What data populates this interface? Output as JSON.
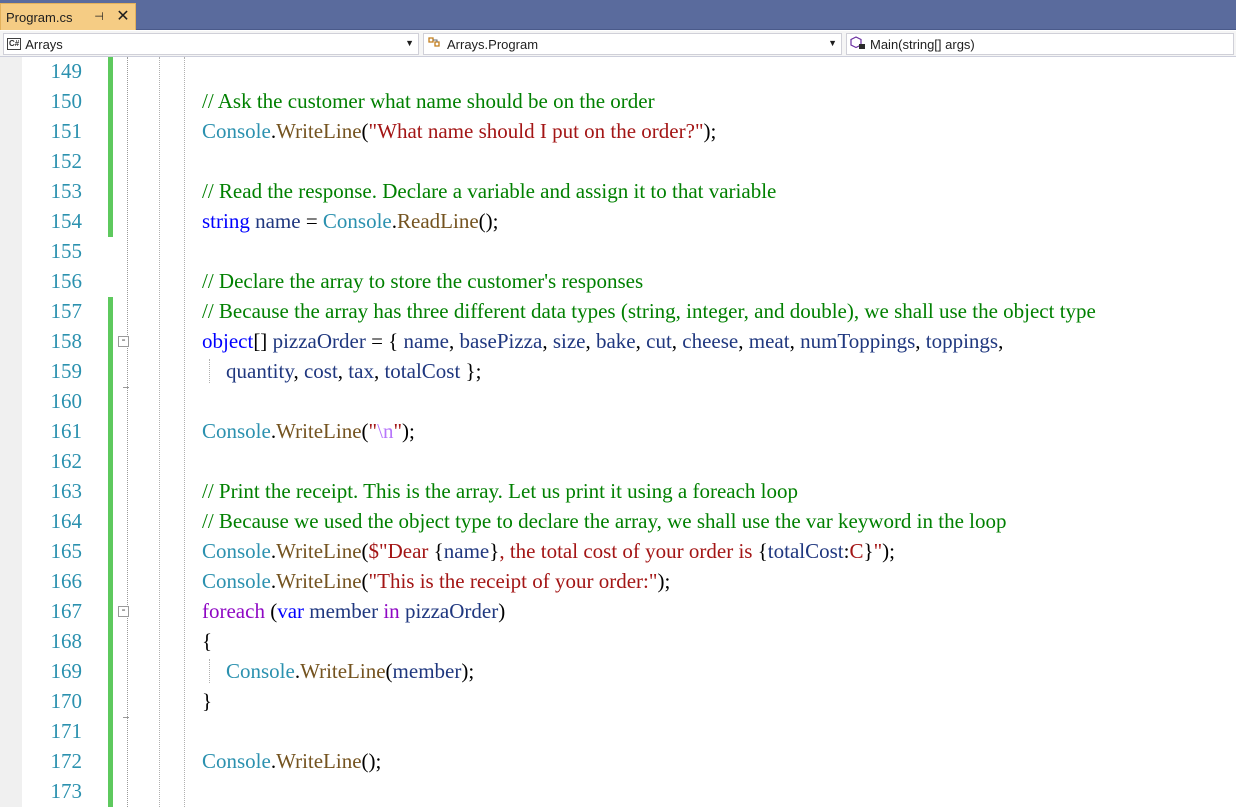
{
  "tab": {
    "title": "Program.cs",
    "pin_glyph": "⊣",
    "close_glyph": "✕"
  },
  "navbar": {
    "project": {
      "badge": "C#",
      "label": "Arrays"
    },
    "type": {
      "label": "Arrays.Program"
    },
    "member": {
      "label": "Main(string[] args)"
    }
  },
  "editor": {
    "line_numbers": [
      "149",
      "150",
      "151",
      "152",
      "153",
      "154",
      "155",
      "156",
      "157",
      "158",
      "159",
      "160",
      "161",
      "162",
      "163",
      "164",
      "165",
      "166",
      "167",
      "168",
      "169",
      "170",
      "171",
      "172",
      "173"
    ],
    "lines": [
      {
        "tokens": []
      },
      {
        "tokens": [
          {
            "t": "// Ask the customer what name should be on the order",
            "c": "com"
          }
        ]
      },
      {
        "tokens": [
          {
            "t": "Console",
            "c": "type"
          },
          {
            "t": ".",
            "c": ""
          },
          {
            "t": "WriteLine",
            "c": "meth"
          },
          {
            "t": "(",
            "c": ""
          },
          {
            "t": "\"What name should I put on the order?\"",
            "c": "str"
          },
          {
            "t": ");",
            "c": ""
          }
        ]
      },
      {
        "tokens": []
      },
      {
        "tokens": [
          {
            "t": "// Read the response. Declare a variable and assign it to that variable",
            "c": "com"
          }
        ]
      },
      {
        "tokens": [
          {
            "t": "string",
            "c": "kw"
          },
          {
            "t": " ",
            "c": ""
          },
          {
            "t": "name",
            "c": "var"
          },
          {
            "t": " = ",
            "c": ""
          },
          {
            "t": "Console",
            "c": "type"
          },
          {
            "t": ".",
            "c": ""
          },
          {
            "t": "ReadLine",
            "c": "meth"
          },
          {
            "t": "();",
            "c": ""
          }
        ]
      },
      {
        "tokens": []
      },
      {
        "tokens": [
          {
            "t": "// Declare the array to store the customer's responses",
            "c": "com"
          }
        ]
      },
      {
        "tokens": [
          {
            "t": "// Because the array has three different data types (string, integer, and double), we shall use the object type",
            "c": "com"
          }
        ]
      },
      {
        "tokens": [
          {
            "t": "object",
            "c": "kw"
          },
          {
            "t": "[] ",
            "c": ""
          },
          {
            "t": "pizzaOrder",
            "c": "var"
          },
          {
            "t": " = { ",
            "c": ""
          },
          {
            "t": "name",
            "c": "var"
          },
          {
            "t": ", ",
            "c": ""
          },
          {
            "t": "basePizza",
            "c": "var"
          },
          {
            "t": ", ",
            "c": ""
          },
          {
            "t": "size",
            "c": "var"
          },
          {
            "t": ", ",
            "c": ""
          },
          {
            "t": "bake",
            "c": "var"
          },
          {
            "t": ", ",
            "c": ""
          },
          {
            "t": "cut",
            "c": "var"
          },
          {
            "t": ", ",
            "c": ""
          },
          {
            "t": "cheese",
            "c": "var"
          },
          {
            "t": ", ",
            "c": ""
          },
          {
            "t": "meat",
            "c": "var"
          },
          {
            "t": ", ",
            "c": ""
          },
          {
            "t": "numToppings",
            "c": "var"
          },
          {
            "t": ", ",
            "c": ""
          },
          {
            "t": "toppings",
            "c": "var"
          },
          {
            "t": ",",
            "c": ""
          }
        ]
      },
      {
        "indent": true,
        "tokens": [
          {
            "t": "quantity",
            "c": "var"
          },
          {
            "t": ", ",
            "c": ""
          },
          {
            "t": "cost",
            "c": "var"
          },
          {
            "t": ", ",
            "c": ""
          },
          {
            "t": "tax",
            "c": "var"
          },
          {
            "t": ", ",
            "c": ""
          },
          {
            "t": "totalCost",
            "c": "var"
          },
          {
            "t": " };",
            "c": ""
          }
        ]
      },
      {
        "tokens": []
      },
      {
        "tokens": [
          {
            "t": "Console",
            "c": "type"
          },
          {
            "t": ".",
            "c": ""
          },
          {
            "t": "WriteLine",
            "c": "meth"
          },
          {
            "t": "(",
            "c": ""
          },
          {
            "t": "\"",
            "c": "str"
          },
          {
            "t": "\\n",
            "c": "esc"
          },
          {
            "t": "\"",
            "c": "str"
          },
          {
            "t": ");",
            "c": ""
          }
        ]
      },
      {
        "tokens": []
      },
      {
        "tokens": [
          {
            "t": "// Print the receipt. This is the array. Let us print it using a foreach loop",
            "c": "com"
          }
        ]
      },
      {
        "tokens": [
          {
            "t": "// Because we used the object type to declare the array, we shall use the var keyword in the loop",
            "c": "com"
          }
        ]
      },
      {
        "tokens": [
          {
            "t": "Console",
            "c": "type"
          },
          {
            "t": ".",
            "c": ""
          },
          {
            "t": "WriteLine",
            "c": "meth"
          },
          {
            "t": "(",
            "c": ""
          },
          {
            "t": "$\"Dear ",
            "c": "str"
          },
          {
            "t": "{",
            "c": ""
          },
          {
            "t": "name",
            "c": "var"
          },
          {
            "t": "}",
            "c": ""
          },
          {
            "t": ", the total cost of your order is ",
            "c": "str"
          },
          {
            "t": "{",
            "c": ""
          },
          {
            "t": "totalCost",
            "c": "var"
          },
          {
            "t": ":",
            "c": ""
          },
          {
            "t": "C",
            "c": "str"
          },
          {
            "t": "}",
            "c": ""
          },
          {
            "t": "\"",
            "c": "str"
          },
          {
            "t": ");",
            "c": ""
          }
        ]
      },
      {
        "tokens": [
          {
            "t": "Console",
            "c": "type"
          },
          {
            "t": ".",
            "c": ""
          },
          {
            "t": "WriteLine",
            "c": "meth"
          },
          {
            "t": "(",
            "c": ""
          },
          {
            "t": "\"This is the receipt of your order:\"",
            "c": "str"
          },
          {
            "t": ");",
            "c": ""
          }
        ]
      },
      {
        "tokens": [
          {
            "t": "foreach",
            "c": "ctl"
          },
          {
            "t": " (",
            "c": ""
          },
          {
            "t": "var",
            "c": "kw"
          },
          {
            "t": " ",
            "c": ""
          },
          {
            "t": "member",
            "c": "var"
          },
          {
            "t": " ",
            "c": ""
          },
          {
            "t": "in",
            "c": "ctl"
          },
          {
            "t": " ",
            "c": ""
          },
          {
            "t": "pizzaOrder",
            "c": "var"
          },
          {
            "t": ")",
            "c": ""
          }
        ]
      },
      {
        "tokens": [
          {
            "t": "{",
            "c": ""
          }
        ]
      },
      {
        "indent": true,
        "tokens": [
          {
            "t": "Console",
            "c": "type"
          },
          {
            "t": ".",
            "c": ""
          },
          {
            "t": "WriteLine",
            "c": "meth"
          },
          {
            "t": "(",
            "c": ""
          },
          {
            "t": "member",
            "c": "var"
          },
          {
            "t": ");",
            "c": ""
          }
        ]
      },
      {
        "tokens": [
          {
            "t": "}",
            "c": ""
          }
        ]
      },
      {
        "tokens": []
      },
      {
        "tokens": [
          {
            "t": "Console",
            "c": "type"
          },
          {
            "t": ".",
            "c": ""
          },
          {
            "t": "WriteLine",
            "c": "meth"
          },
          {
            "t": "();",
            "c": ""
          }
        ]
      },
      {
        "tokens": []
      }
    ]
  },
  "colors": {
    "comment": "#008000",
    "keyword": "#0000ff",
    "control": "#8f08c4",
    "type": "#2b91af",
    "method": "#74531f",
    "variable": "#1f377f",
    "string": "#a31515",
    "escape": "#b776fb",
    "line_number": "#2b91af",
    "change_marker": "#5ec95e",
    "tab_active": "#f5cc84",
    "tabstrip": "#5a6b9d"
  }
}
